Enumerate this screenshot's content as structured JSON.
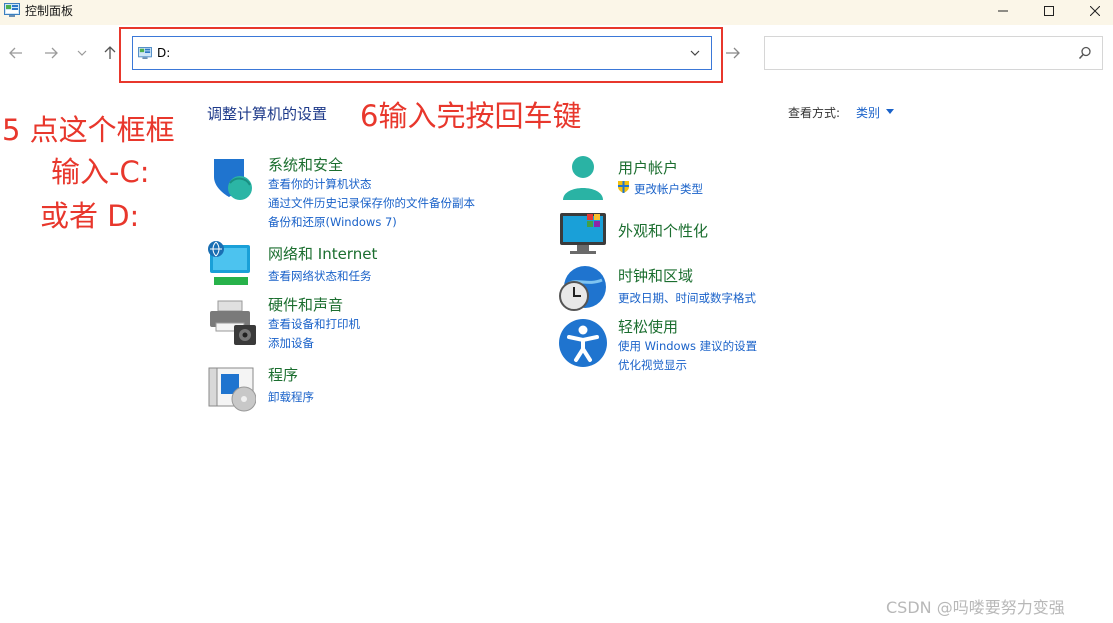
{
  "window": {
    "title": "控制面板"
  },
  "nav": {
    "address_value": "D:",
    "search_placeholder": ""
  },
  "content": {
    "heading": "调整计算机的设置",
    "view_label": "查看方式:",
    "view_value": "类别"
  },
  "annotations": {
    "step5": "5 点这个框框",
    "step5_line2": "输入-C:",
    "step5_line3": "或者 D:",
    "step6": "6输入完按回车键"
  },
  "categories": {
    "system_security": {
      "title": "系统和安全",
      "links": [
        "查看你的计算机状态",
        "通过文件历史记录保存你的文件备份副本",
        "备份和还原(Windows 7)"
      ]
    },
    "network": {
      "title": "网络和 Internet",
      "links": [
        "查看网络状态和任务"
      ]
    },
    "hardware_sound": {
      "title": "硬件和声音",
      "links": [
        "查看设备和打印机",
        "添加设备"
      ]
    },
    "programs": {
      "title": "程序",
      "links": [
        "卸载程序"
      ]
    },
    "user_accounts": {
      "title": "用户帐户",
      "links": [
        "更改帐户类型"
      ]
    },
    "appearance": {
      "title": "外观和个性化",
      "links": []
    },
    "clock_region": {
      "title": "时钟和区域",
      "links": [
        "更改日期、时间或数字格式"
      ]
    },
    "ease_of_access": {
      "title": "轻松使用",
      "links": [
        "使用 Windows 建议的设置",
        "优化视觉显示"
      ]
    }
  },
  "watermark": "CSDN @吗喽要努力变强",
  "colors": {
    "annotation": "#e8372c",
    "link": "#1a62c9",
    "category_title": "#1b6e2f",
    "heading": "#1e3a8a",
    "titlebar": "#fbf6e8"
  }
}
